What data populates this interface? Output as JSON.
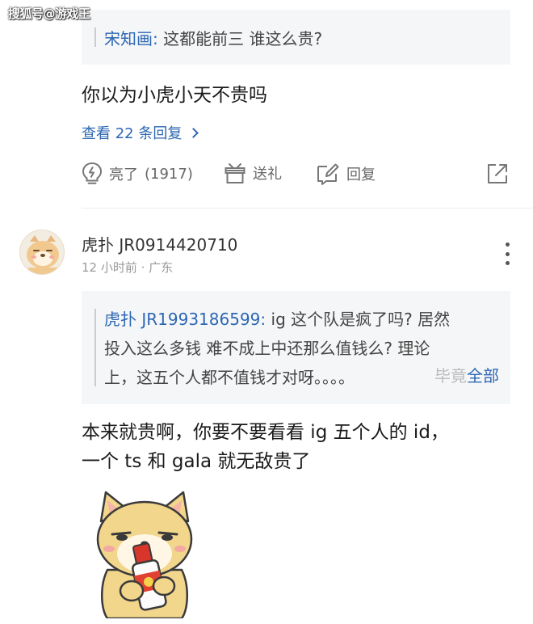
{
  "watermark": "搜狐号@游戏王",
  "thread": {
    "quote1": {
      "author": "宋知画",
      "text": "这都能前三 谁这么贵?"
    },
    "comment1": "你以为小虎小天不贵吗",
    "view_replies": "查看 22 条回复",
    "actions": {
      "like_label": "亮了",
      "like_count": "(1917)",
      "gift_label": "送礼",
      "reply_label": "回复"
    }
  },
  "comment2": {
    "username": "虎扑 JR0914420710",
    "meta": "12 小时前 · 广东",
    "quote": {
      "author": "虎扑 JR1993186599",
      "line1": "ig 这个队是疯了吗? 居然",
      "line2": "投入这么多钱  难不成上中还那么值钱么? 理论",
      "line3": "上，这五个人都不值钱才对呀。。。。",
      "faded": "毕竟",
      "expand": "全部"
    },
    "text_line1": "本来就贵啊，你要不要看看 ig 五个人的 id，",
    "text_line2": "一个 ts 和 gala 就无敌贵了"
  },
  "icons": {
    "like": "lightbulb-icon",
    "gift": "gift-icon",
    "reply": "edit-reply-icon",
    "share": "share-icon",
    "more": "more-vertical-icon"
  },
  "colors": {
    "link": "#2d67b3",
    "quote_bg": "#f5f6f8"
  }
}
